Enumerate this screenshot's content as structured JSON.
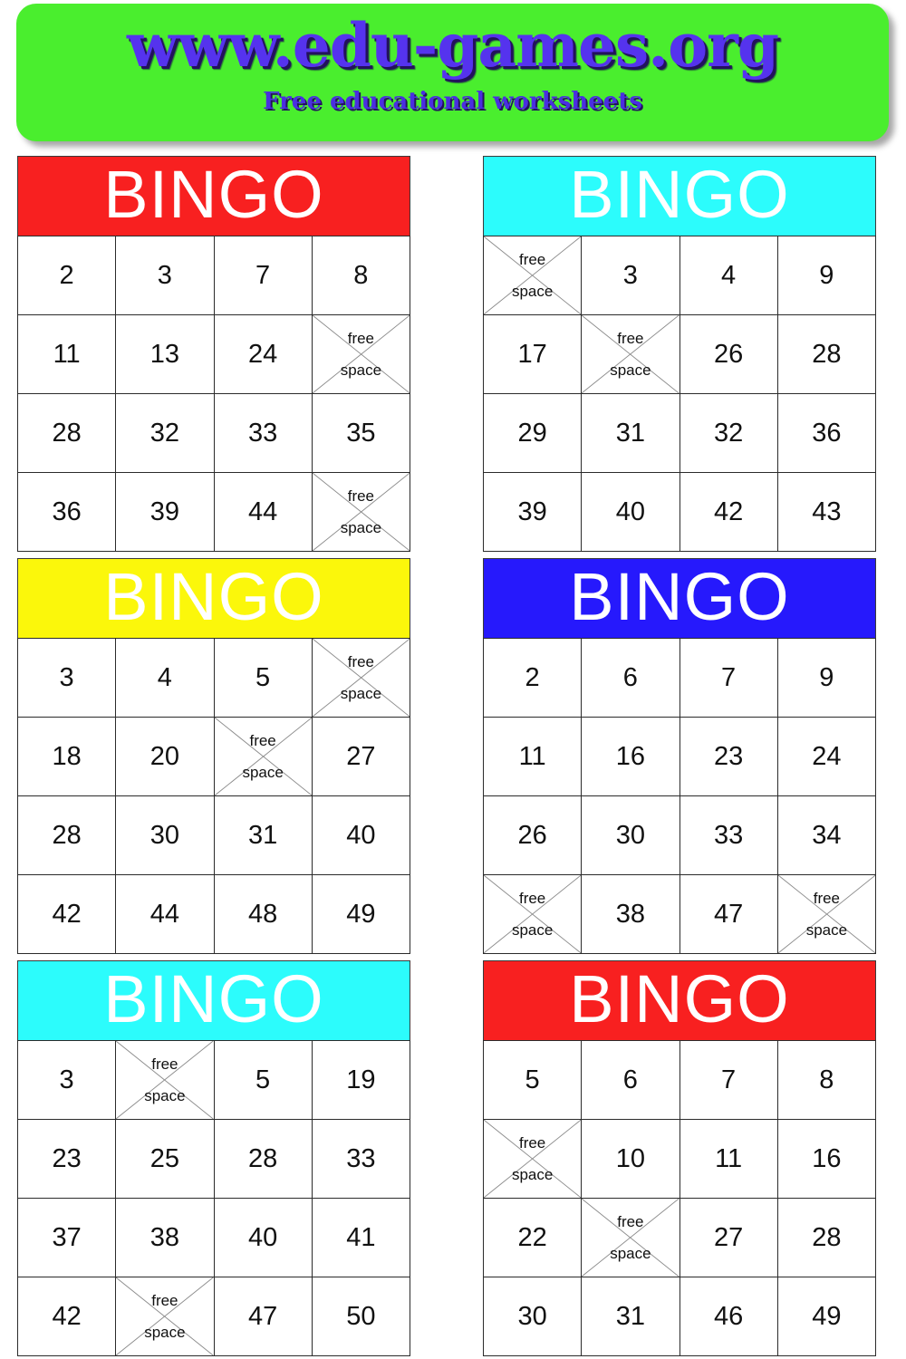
{
  "banner": {
    "title": "www.edu-games.org",
    "subtitle": "Free educational worksheets",
    "background_color": "#4AEE2E",
    "text_color": "#5533EE"
  },
  "labels": {
    "bingo_word": "BINGO",
    "free_line1": "free",
    "free_line2": "space"
  },
  "palette": {
    "red": "#F82020",
    "cyan": "#2CFCFC",
    "yellow": "#FBF70B",
    "blue": "#2619FC",
    "header_text": "#FFFFFF",
    "grid_line": "#2b2b2b",
    "free_x_line": "#8a8a8a"
  },
  "cards": [
    {
      "id": "card-1",
      "position": "top-left",
      "header_color": "#F82020",
      "title": "BINGO",
      "rows": [
        [
          "2",
          "3",
          "7",
          "8"
        ],
        [
          "11",
          "13",
          "24",
          "free space"
        ],
        [
          "28",
          "32",
          "33",
          "35"
        ],
        [
          "36",
          "39",
          "44",
          "free space"
        ]
      ]
    },
    {
      "id": "card-2",
      "position": "top-right",
      "header_color": "#2CFCFC",
      "title": "BINGO",
      "rows": [
        [
          "free space",
          "3",
          "4",
          "9"
        ],
        [
          "17",
          "free space",
          "26",
          "28"
        ],
        [
          "29",
          "31",
          "32",
          "36"
        ],
        [
          "39",
          "40",
          "42",
          "43"
        ]
      ]
    },
    {
      "id": "card-3",
      "position": "middle-left",
      "header_color": "#FBF70B",
      "title": "BINGO",
      "rows": [
        [
          "3",
          "4",
          "5",
          "free space"
        ],
        [
          "18",
          "20",
          "free space",
          "27"
        ],
        [
          "28",
          "30",
          "31",
          "40"
        ],
        [
          "42",
          "44",
          "48",
          "49"
        ]
      ]
    },
    {
      "id": "card-4",
      "position": "middle-right",
      "header_color": "#2619FC",
      "title": "BINGO",
      "rows": [
        [
          "2",
          "6",
          "7",
          "9"
        ],
        [
          "11",
          "16",
          "23",
          "24"
        ],
        [
          "26",
          "30",
          "33",
          "34"
        ],
        [
          "free space",
          "38",
          "47",
          "free space"
        ]
      ]
    },
    {
      "id": "card-5",
      "position": "bottom-left",
      "header_color": "#2CFCFC",
      "title": "BINGO",
      "rows": [
        [
          "3",
          "free space",
          "5",
          "19"
        ],
        [
          "23",
          "25",
          "28",
          "33"
        ],
        [
          "37",
          "38",
          "40",
          "41"
        ],
        [
          "42",
          "free space",
          "47",
          "50"
        ]
      ]
    },
    {
      "id": "card-6",
      "position": "bottom-right",
      "header_color": "#F82020",
      "title": "BINGO",
      "rows": [
        [
          "5",
          "6",
          "7",
          "8"
        ],
        [
          "free space",
          "10",
          "11",
          "16"
        ],
        [
          "22",
          "free space",
          "27",
          "28"
        ],
        [
          "30",
          "31",
          "46",
          "49"
        ]
      ]
    }
  ]
}
